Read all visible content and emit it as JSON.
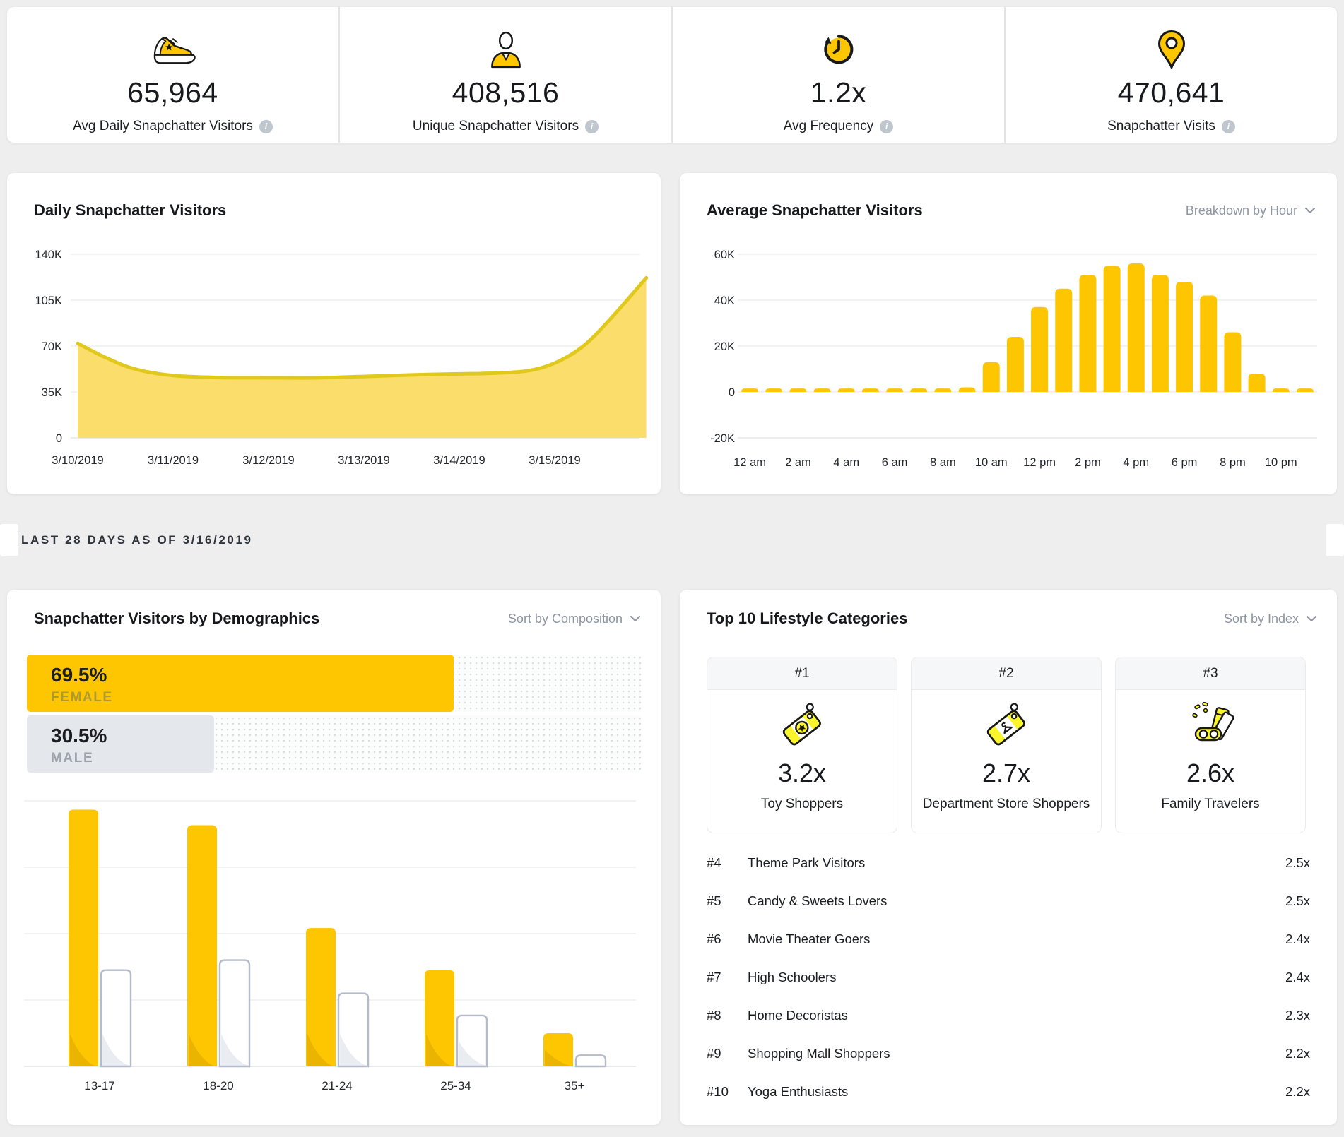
{
  "stats": [
    {
      "icon": "sneaker-icon",
      "value": "65,964",
      "label": "Avg Daily Snapchatter Visitors"
    },
    {
      "icon": "person-icon",
      "value": "408,516",
      "label": "Unique Snapchatter Visitors"
    },
    {
      "icon": "clock-icon",
      "value": "1.2x",
      "label": "Avg Frequency"
    },
    {
      "icon": "location-pin-icon",
      "value": "470,641",
      "label": "Snapchatter Visits"
    }
  ],
  "section_label": "LAST 28 DAYS AS OF 3/16/2019",
  "daily_chart": {
    "title": "Daily Snapchatter Visitors"
  },
  "hourly_chart": {
    "title": "Average Snapchatter Visitors",
    "dropdown": "Breakdown by Hour"
  },
  "demographics": {
    "title": "Snapchatter Visitors by Demographics",
    "dropdown": "Sort by Composition",
    "gender": [
      {
        "label": "FEMALE",
        "value": "69.5%",
        "pct": 69.5
      },
      {
        "label": "MALE",
        "value": "30.5%",
        "pct": 30.5
      }
    ]
  },
  "lifestyle": {
    "title": "Top 10 Lifestyle Categories",
    "dropdown": "Sort by Index",
    "top3": [
      {
        "rank": "#1",
        "icon": "price-tag-star-icon",
        "value": "3.2x",
        "label": "Toy Shoppers"
      },
      {
        "rank": "#2",
        "icon": "price-tag-hanger-icon",
        "value": "2.7x",
        "label": "Department Store Shoppers"
      },
      {
        "rank": "#3",
        "icon": "travel-tickets-icon",
        "value": "2.6x",
        "label": "Family Travelers"
      }
    ],
    "list": [
      {
        "rank": "#4",
        "label": "Theme Park Visitors",
        "value": "2.5x"
      },
      {
        "rank": "#5",
        "label": "Candy & Sweets Lovers",
        "value": "2.5x"
      },
      {
        "rank": "#6",
        "label": "Movie Theater Goers",
        "value": "2.4x"
      },
      {
        "rank": "#7",
        "label": "High Schoolers",
        "value": "2.4x"
      },
      {
        "rank": "#8",
        "label": "Home Decoristas",
        "value": "2.3x"
      },
      {
        "rank": "#9",
        "label": "Shopping Mall Shoppers",
        "value": "2.2x"
      },
      {
        "rank": "#10",
        "label": "Yoga Enthusiasts",
        "value": "2.2x"
      }
    ]
  },
  "colors": {
    "accent_yellow": "#FEC601",
    "area_fill": "#FBDD6B",
    "area_line": "#E0C91A",
    "icon_yellow": "#FBF62B",
    "male_gray": "#E4E7EB",
    "gridline": "#ECECEE",
    "axis_text": "#23272C"
  },
  "chart_data": [
    {
      "type": "area",
      "title": "Daily Snapchatter Visitors",
      "x_labels": [
        "3/10/2019",
        "3/11/2019",
        "3/12/2019",
        "3/13/2019",
        "3/14/2019",
        "3/15/2019"
      ],
      "y_ticks": [
        "0",
        "35K",
        "70K",
        "105K",
        "140K"
      ],
      "ylim": [
        0,
        140000
      ],
      "points_day_visitorsK": [
        [
          0,
          72
        ],
        [
          0.3,
          61
        ],
        [
          0.6,
          52.5
        ],
        [
          1,
          47.5
        ],
        [
          1.5,
          46
        ],
        [
          2,
          45.8
        ],
        [
          2.5,
          45.8
        ],
        [
          3,
          46.8
        ],
        [
          3.5,
          48
        ],
        [
          4,
          48.8
        ],
        [
          4.3,
          49.2
        ],
        [
          4.7,
          51
        ],
        [
          5,
          57
        ],
        [
          5.3,
          70
        ],
        [
          5.6,
          92
        ],
        [
          5.96,
          122
        ]
      ]
    },
    {
      "type": "bar",
      "title": "Average Snapchatter Visitors",
      "breakdown": "Breakdown by Hour",
      "x_labels": [
        "12 am",
        "2 am",
        "4 am",
        "6 am",
        "8 am",
        "10 am",
        "12 pm",
        "2 pm",
        "4 pm",
        "6 pm",
        "8 pm",
        "10 pm"
      ],
      "y_ticks": [
        "-20K",
        "0",
        "20K",
        "40K",
        "60K"
      ],
      "ylim": [
        -20000,
        60000
      ],
      "values_K": [
        1.5,
        1.5,
        1.5,
        1.5,
        1.5,
        1.5,
        1.5,
        1.5,
        1.5,
        2,
        13,
        24,
        37,
        45,
        51,
        55,
        56,
        51,
        48,
        42,
        26,
        8,
        1.5,
        1.5
      ]
    },
    {
      "type": "bar",
      "title": "Snapchatter Visitors by Demographics (age groups)",
      "categories": [
        "13-17",
        "18-20",
        "21-24",
        "25-34",
        "35+"
      ],
      "series": [
        {
          "name": "Female",
          "values_pct": [
            23.2,
            21.8,
            12.5,
            8.7,
            3.0
          ]
        },
        {
          "name": "Male",
          "values_pct": [
            8.7,
            9.6,
            6.6,
            4.6,
            1.0
          ]
        }
      ],
      "gender_split": {
        "female_pct": 69.5,
        "male_pct": 30.5
      }
    }
  ]
}
